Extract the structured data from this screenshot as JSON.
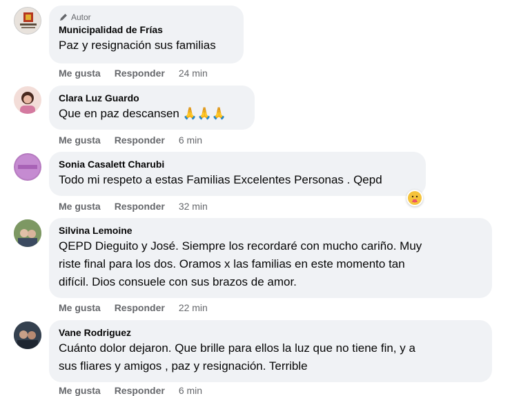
{
  "comments": [
    {
      "author_tag": "Autor",
      "author": "Municipalidad de Frías",
      "text": "Paz y resignación sus familias",
      "like": "Me gusta",
      "reply": "Responder",
      "time": "24 min"
    },
    {
      "author": "Clara Luz Guardo",
      "text": "Que en paz descansen 🙏🙏🙏",
      "like": "Me gusta",
      "reply": "Responder",
      "time": "6 min"
    },
    {
      "author": "Sonia Casalett Charubi",
      "text": "Todo mi respeto a estas Familias Excelentes Personas . Qepd",
      "like": "Me gusta",
      "reply": "Responder",
      "time": "32 min",
      "reaction": "care-emoji"
    },
    {
      "author": "Silvina Lemoine",
      "text_lines": [
        "QEPD Dieguito y José. Siempre los recordaré con mucho cariño. Muy",
        "riste final para los dos. Oramos x las familias en este momento tan",
        "difícil. Dios consuele con sus brazos de amor."
      ],
      "like": "Me gusta",
      "reply": "Responder",
      "time": "22 min"
    },
    {
      "author": "Vane Rodriguez",
      "text_lines": [
        "Cuánto dolor dejaron. Que brille para ellos la luz que no tiene fin, y a",
        "sus fliares y amigos , paz y resignación. Terrible"
      ],
      "like": "Me gusta",
      "reply": "Responder",
      "time": "6 min"
    }
  ],
  "colors": {
    "bubble": "#f0f2f5",
    "meta": "#65676b",
    "text": "#050505"
  }
}
